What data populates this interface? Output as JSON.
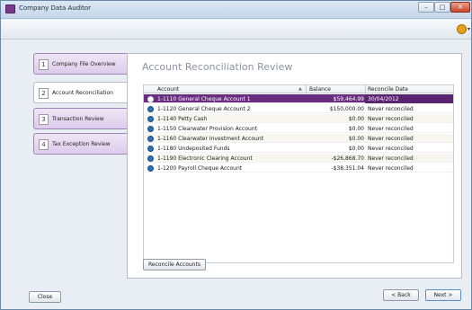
{
  "window": {
    "title": "Company Data Auditor",
    "minimize_glyph": "–",
    "maximize_glyph": "□",
    "close_glyph": "✕",
    "help_caret": "▾"
  },
  "nav": {
    "items": [
      {
        "num": "1",
        "label": "Company File Overview"
      },
      {
        "num": "2",
        "label": "Account Reconciliation"
      },
      {
        "num": "3",
        "label": "Transaction Review"
      },
      {
        "num": "4",
        "label": "Tax Exception Review"
      }
    ],
    "active_index": 1
  },
  "content": {
    "title": "Account Reconciliation Review"
  },
  "grid": {
    "columns": {
      "account": "Account",
      "balance": "Balance",
      "reconcile_date": "Reconcile Date"
    },
    "sort_indicator": "▲",
    "rows": [
      {
        "account": "1-1110  General Cheque Account 1",
        "balance": "$59,464.99",
        "date": "30/04/2012",
        "selected": true
      },
      {
        "account": "1-1120  General Cheque Account 2",
        "balance": "$150,000.00",
        "date": "Never reconciled"
      },
      {
        "account": "1-1140  Petty Cash",
        "balance": "$0.00",
        "date": "Never reconciled"
      },
      {
        "account": "1-1150  Clearwater Provision Account",
        "balance": "$0.00",
        "date": "Never reconciled"
      },
      {
        "account": "1-1160  Clearwater Investment Account",
        "balance": "$0.00",
        "date": "Never reconciled"
      },
      {
        "account": "1-1180  Undeposited Funds",
        "balance": "$0.00",
        "date": "Never reconciled"
      },
      {
        "account": "1-1190  Electronic Clearing Account",
        "balance": "-$26,868.70",
        "date": "Never reconciled"
      },
      {
        "account": "1-1200  Payroll Cheque Account",
        "balance": "-$38,351.04",
        "date": "Never reconciled"
      }
    ]
  },
  "buttons": {
    "reconcile": "Reconcile Accounts",
    "close": "Close",
    "back": "< Back",
    "next": "Next >"
  },
  "colors": {
    "accent": "#6a2c7f",
    "nav_tab": "#ddcbeb",
    "row_icon": "#2f6fb6"
  }
}
